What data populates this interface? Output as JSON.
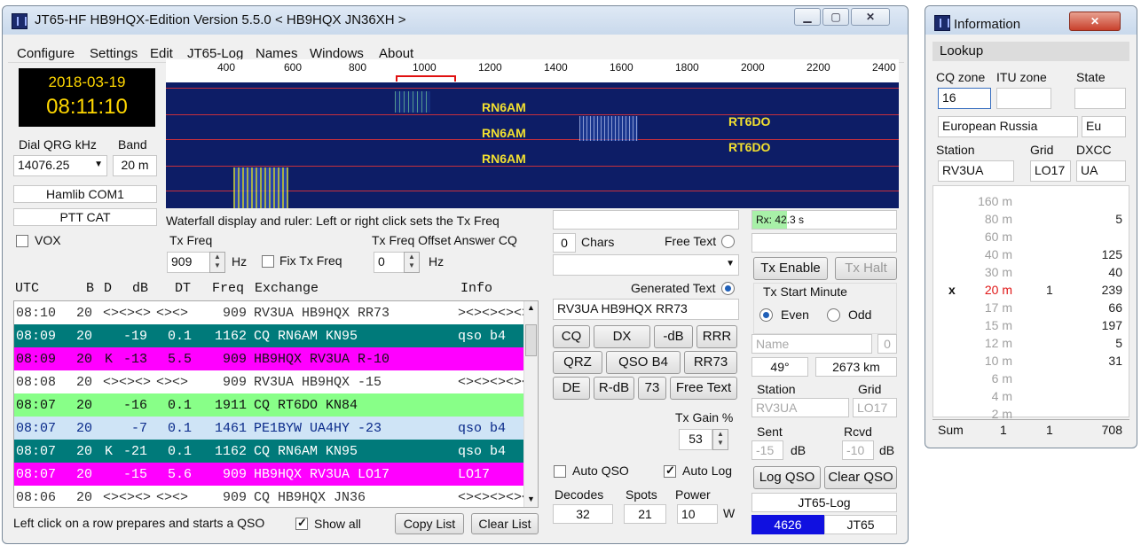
{
  "main_window": {
    "title": "JT65-HF HB9HQX-Edition Version 5.5.0   < HB9HQX JN36XH >",
    "menu": [
      "Configure",
      "Settings",
      "Edit",
      "JT65-Log",
      "Names",
      "Windows",
      "About"
    ],
    "date": "2018-03-19",
    "time": "08:11:10",
    "dial_qrg_label": "Dial QRG kHz",
    "dial_qrg_value": "14076.25",
    "band_label": "Band",
    "band_value": "20 m",
    "rig_port": "Hamlib COM1",
    "ptt": "PTT CAT",
    "vox_label": "VOX",
    "ruler_ticks": [
      "400",
      "600",
      "800",
      "1000",
      "1200",
      "1400",
      "1600",
      "1800",
      "2000",
      "2200",
      "2400"
    ],
    "waterfall_labels": [
      "RN6AM",
      "RN6AM",
      "RN6AM",
      "RT6DO",
      "RT6DO"
    ],
    "waterfall_hint": "Waterfall display and ruler: Left or right click sets the Tx Freq",
    "tx_freq_label": "Tx Freq",
    "tx_freq_value": "909",
    "tx_freq_unit": "Hz",
    "fix_tx_freq_label": "Fix Tx Freq",
    "tx_offset_label": "Tx Freq Offset Answer CQ",
    "tx_offset_value": "0",
    "tx_offset_unit": "Hz",
    "columns": [
      "UTC",
      "B",
      "D",
      "dB",
      "DT",
      "Freq",
      "Exchange",
      "Info"
    ],
    "rows": [
      {
        "utc": "08:10",
        "b": "20",
        "d": "",
        "db": "<><><>",
        "dt": "<><>",
        "freq": "909",
        "exchange": "RV3UA HB9HQX RR73",
        "info": "><><><><><>"
      },
      {
        "utc": "08:09",
        "b": "20",
        "d": "",
        "db": "-19",
        "dt": "0.1",
        "freq": "1162",
        "exchange": "CQ RN6AM KN95",
        "info": "qso b4"
      },
      {
        "utc": "08:09",
        "b": "20",
        "d": "K",
        "db": "-13",
        "dt": "5.5",
        "freq": "909",
        "exchange": "HB9HQX RV3UA R-10",
        "info": ""
      },
      {
        "utc": "08:08",
        "b": "20",
        "d": "",
        "db": "<><><>",
        "dt": "<><>",
        "freq": "909",
        "exchange": "RV3UA HB9HQX -15",
        "info": "<><><><><><>"
      },
      {
        "utc": "08:07",
        "b": "20",
        "d": "",
        "db": "-16",
        "dt": "0.1",
        "freq": "1911",
        "exchange": "CQ RT6DO KN84",
        "info": ""
      },
      {
        "utc": "08:07",
        "b": "20",
        "d": "",
        "db": "-7",
        "dt": "0.1",
        "freq": "1461",
        "exchange": "PE1BYW UA4HY -23",
        "info": "qso b4"
      },
      {
        "utc": "08:07",
        "b": "20",
        "d": "K",
        "db": "-21",
        "dt": "0.1",
        "freq": "1162",
        "exchange": "CQ RN6AM KN95",
        "info": "qso b4"
      },
      {
        "utc": "08:07",
        "b": "20",
        "d": "",
        "db": "-15",
        "dt": "5.6",
        "freq": "909",
        "exchange": "HB9HQX RV3UA LO17",
        "info": "LO17"
      },
      {
        "utc": "08:06",
        "b": "20",
        "d": "",
        "db": "<><><>",
        "dt": "<><>",
        "freq": "909",
        "exchange": "CQ HB9HQX JN36",
        "info": "<><><><><><>"
      }
    ],
    "row_colors": [
      "#ffffff",
      "#007a7a",
      "#ff00ff",
      "#ffffff",
      "#88ff88",
      "#cfe4f6",
      "#007a7a",
      "#ff00ff",
      "#ffffff"
    ],
    "row_text_colors": [
      "#333333",
      "#ffffff",
      "#111111",
      "#333333",
      "#111111",
      "#0a2a8a",
      "#ffffff",
      "#ffffff",
      "#333333"
    ],
    "footer_hint": "Left click on a row prepares and starts a QSO",
    "show_all_label": "Show all",
    "copy_list_label": "Copy List",
    "clear_list_label": "Clear List",
    "chars_value": "0",
    "chars_label": "Chars",
    "free_text_label": "Free Text",
    "generated_text_label": "Generated Text",
    "generated_text_value": "RV3UA HB9HQX RR73",
    "macro_buttons_row1": [
      "CQ",
      "DX",
      "-dB",
      "RRR"
    ],
    "macro_buttons_row2": [
      "QRZ",
      "QSO B4",
      "RR73"
    ],
    "macro_buttons_row3": [
      "DE",
      "R-dB",
      "73",
      "Free Text"
    ],
    "tx_gain_label": "Tx Gain %",
    "tx_gain_value": "53",
    "auto_qso_label": "Auto QSO",
    "auto_log_label": "Auto Log",
    "decodes_label": "Decodes",
    "decodes_value": "32",
    "spots_label": "Spots",
    "spots_value": "21",
    "power_label": "Power",
    "power_value": "10",
    "power_unit": "W",
    "rx_status": "Rx: 42.3 s",
    "rx_progress": 0.24,
    "tx_enable_label": "Tx Enable",
    "tx_halt_label": "Tx Halt",
    "tx_start_minute_label": "Tx Start Minute",
    "even_label": "Even",
    "odd_label": "Odd",
    "name_placeholder": "Name",
    "name_count": "0",
    "bearing": "49°",
    "distance": "2673 km",
    "station_label": "Station",
    "grid_label": "Grid",
    "station_value": "RV3UA",
    "grid_value": "LO17",
    "sent_label": "Sent",
    "rcvd_label": "Rcvd",
    "sent_value": "-15",
    "rcvd_value": "-10",
    "db_unit": "dB",
    "log_qso_label": "Log QSO",
    "clear_qso_label": "Clear QSO",
    "jt65_log_label": "JT65-Log",
    "log_count": "4626",
    "mode": "JT65"
  },
  "info_window": {
    "title": "Information",
    "lookup_label": "Lookup",
    "cq_zone_label": "CQ zone",
    "itu_zone_label": "ITU zone",
    "state_label": "State",
    "cq_zone_value": "16",
    "country": "European Russia",
    "continent": "Eu",
    "station_label": "Station",
    "grid_label": "Grid",
    "dxcc_label": "DXCC",
    "station_value": "RV3UA",
    "grid_value": "LO17",
    "dxcc_value": "UA",
    "bands": [
      {
        "mark": "",
        "band": "160 m",
        "c1": "",
        "c2": ""
      },
      {
        "mark": "",
        "band": "80 m",
        "c1": "",
        "c2": "5"
      },
      {
        "mark": "",
        "band": "60 m",
        "c1": "",
        "c2": ""
      },
      {
        "mark": "",
        "band": "40 m",
        "c1": "",
        "c2": "125"
      },
      {
        "mark": "",
        "band": "30 m",
        "c1": "",
        "c2": "40"
      },
      {
        "mark": "x",
        "band": "20 m",
        "c1": "1",
        "c2": "239"
      },
      {
        "mark": "",
        "band": "17 m",
        "c1": "",
        "c2": "66"
      },
      {
        "mark": "",
        "band": "15 m",
        "c1": "",
        "c2": "197"
      },
      {
        "mark": "",
        "band": "12 m",
        "c1": "",
        "c2": "5"
      },
      {
        "mark": "",
        "band": "10 m",
        "c1": "",
        "c2": "31"
      },
      {
        "mark": "",
        "band": "6 m",
        "c1": "",
        "c2": ""
      },
      {
        "mark": "",
        "band": "4 m",
        "c1": "",
        "c2": ""
      },
      {
        "mark": "",
        "band": "2 m",
        "c1": "",
        "c2": ""
      }
    ],
    "sum_label": "Sum",
    "sum_c1": "1",
    "sum_c2": "1",
    "sum_c3": "708"
  }
}
